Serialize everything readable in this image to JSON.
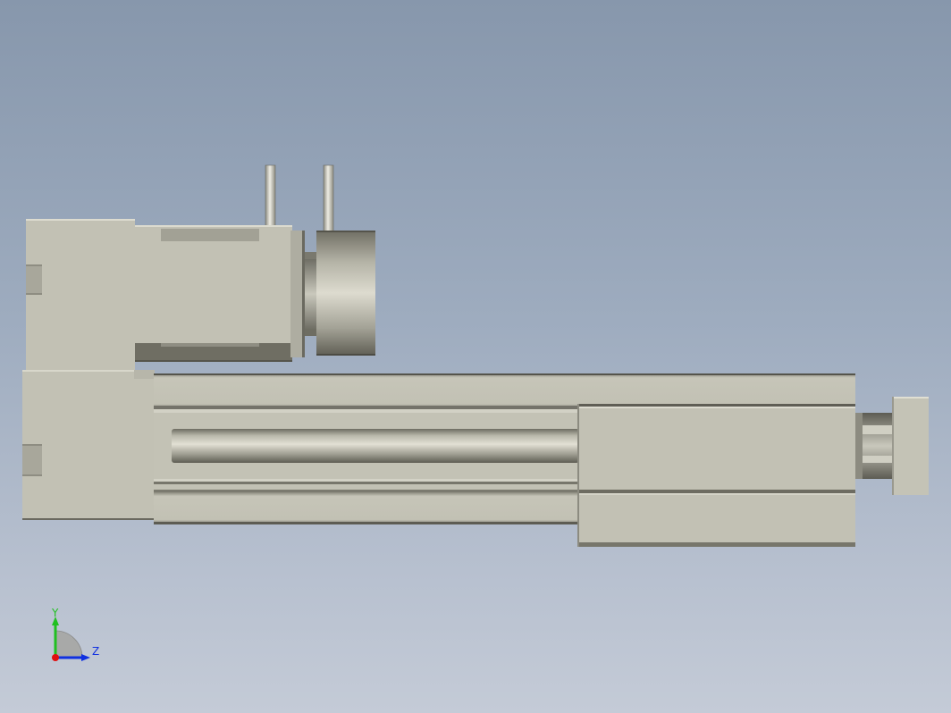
{
  "viewport": {
    "background_top": "#8797ac",
    "background_bottom": "#c4cbd7"
  },
  "model": {
    "body_color": "#c2c1b4",
    "shade_color": "#77766a",
    "highlight_color": "#dedcd0"
  },
  "triad": {
    "y_label": "Y",
    "z_label": "Z",
    "y_color": "#20c020",
    "z_color": "#1030e0",
    "x_color": "#e01010"
  }
}
